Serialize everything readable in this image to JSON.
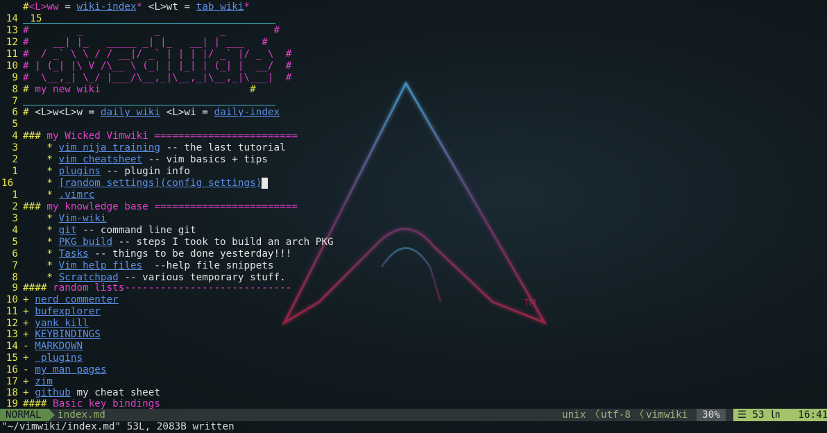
{
  "colors": {
    "yellow": "#e5e54b",
    "magenta": "#e040c8",
    "link": "#5b8ee6",
    "rule": "#3fb6c9",
    "mode_bg": "#5f8a4a",
    "pos_bg": "#a3c46a"
  },
  "lines": {
    "l15": {
      "num": "15",
      "hash": "#",
      "k1": "<L>ww",
      "eq1": " = ",
      "link1": "wiki-index",
      "star1": "*",
      "sp": " ",
      "k2": "<L>wt",
      "eq2": " = ",
      "link2": "tab wiki",
      "star2": "*"
    },
    "l14": {
      "num": "14"
    },
    "l13": {
      "num": "13",
      "text": "#        _            _          _        #"
    },
    "l12": {
      "num": "12",
      "text": "#    __| |_   _____ _| |_   __| | ___   #"
    },
    "l11": {
      "num": "11",
      "text": "#  / _` \\ \\ / / __|/ _` | | | |/ _` |/ _ \\  #"
    },
    "l10": {
      "num": "10",
      "text": "# | (_| |\\ V /\\__ \\ (_| | |_| | (_| |  __/  #"
    },
    "l9": {
      "num": "9",
      "text": "#  \\__,_| \\_/ |___/\\__,_|\\__,_|\\__,_|\\___|  #"
    },
    "l8": {
      "num": "8",
      "hash": "#",
      "text": " my new wiki",
      "tail": "                         #"
    },
    "l7": {
      "num": "7"
    },
    "l6": {
      "num": "6",
      "hash": "#",
      "k1": " <L>w<L>w",
      "eq1": " = ",
      "link1": "daily wiki",
      "k2": " <L>wi",
      "eq2": " = ",
      "link2": "daily-index"
    },
    "l5": {
      "num": "5"
    },
    "l4": {
      "num": "4",
      "hash": "###",
      "heading": " my Wicked Vimwiki ========================"
    },
    "l3a": {
      "num": "3",
      "bullet": "    *",
      "link": "vim nija training",
      "rest": " -- the last tutorial"
    },
    "l2a": {
      "num": "2",
      "bullet": "    *",
      "link": "vim cheatsheet",
      "rest": " -- vim basics + tips"
    },
    "l1a": {
      "num": "1",
      "bullet": "    *",
      "link": "plugins",
      "rest": " -- plugin info"
    },
    "l16": {
      "num": "16",
      "bullet": "    *",
      "link": "[random settings](config settings)",
      "cursor": " "
    },
    "l1b": {
      "num": "1",
      "bullet": "    *",
      "link": ".vimrc"
    },
    "l2b": {
      "num": "2",
      "hash": "###",
      "heading": " my knowledge base ========================"
    },
    "l3b": {
      "num": "3",
      "bullet": "    *",
      "link": "Vim-wiki"
    },
    "l4b": {
      "num": "4",
      "bullet": "    *",
      "link": "git",
      "rest": " -- command line git"
    },
    "l5b": {
      "num": "5",
      "bullet": "    *",
      "link": "PKG build",
      "rest": " -- steps I took to build an arch PKG"
    },
    "l6b": {
      "num": "6",
      "bullet": "    *",
      "link": "Tasks",
      "rest": " -- things to be done yesterday!!!"
    },
    "l7b": {
      "num": "7",
      "bullet": "    *",
      "link": "Vim help files",
      "rest": "  --help file snippets"
    },
    "l8b": {
      "num": "8",
      "bullet": "    *",
      "link": "Scratchpad",
      "rest": " -- various temporary stuff."
    },
    "l9b": {
      "num": "9",
      "hash": "####",
      "heading": " random lists----------------------------"
    },
    "l10b": {
      "num": "10",
      "bullet": "+",
      "link": "nerd commenter"
    },
    "l11b": {
      "num": "11",
      "bullet": "+",
      "link": "bufexplorer"
    },
    "l12b": {
      "num": "12",
      "bullet": "+",
      "link": "yank kill"
    },
    "l13b": {
      "num": "13",
      "bullet": "+",
      "link": "KEYBINDINGS"
    },
    "l14b": {
      "num": "14",
      "bullet": "-",
      "link": "MARKDOWN"
    },
    "l15b": {
      "num": "15",
      "bullet": "+",
      "link": " plugins"
    },
    "l16b": {
      "num": "16",
      "bullet": "-",
      "link": "my man pages"
    },
    "l17b": {
      "num": "17",
      "bullet": "+",
      "link": "zim"
    },
    "l18b": {
      "num": "18",
      "bullet": "+",
      "link": "github",
      "rest": " my cheat sheet"
    },
    "l19b": {
      "num": "19",
      "hash": "####",
      "heading": " Basic key bindings"
    }
  },
  "statusline": {
    "mode": "NORMAL",
    "filename": "index.md",
    "fileformat": "unix",
    "sep": "〈",
    "encoding": "utf-8",
    "filetype": "vimwiki",
    "percent": "30%",
    "position": "☰ 53 ㏑   16:41"
  },
  "message": "\"~/vimwiki/index.md\" 53L, 2083B written"
}
